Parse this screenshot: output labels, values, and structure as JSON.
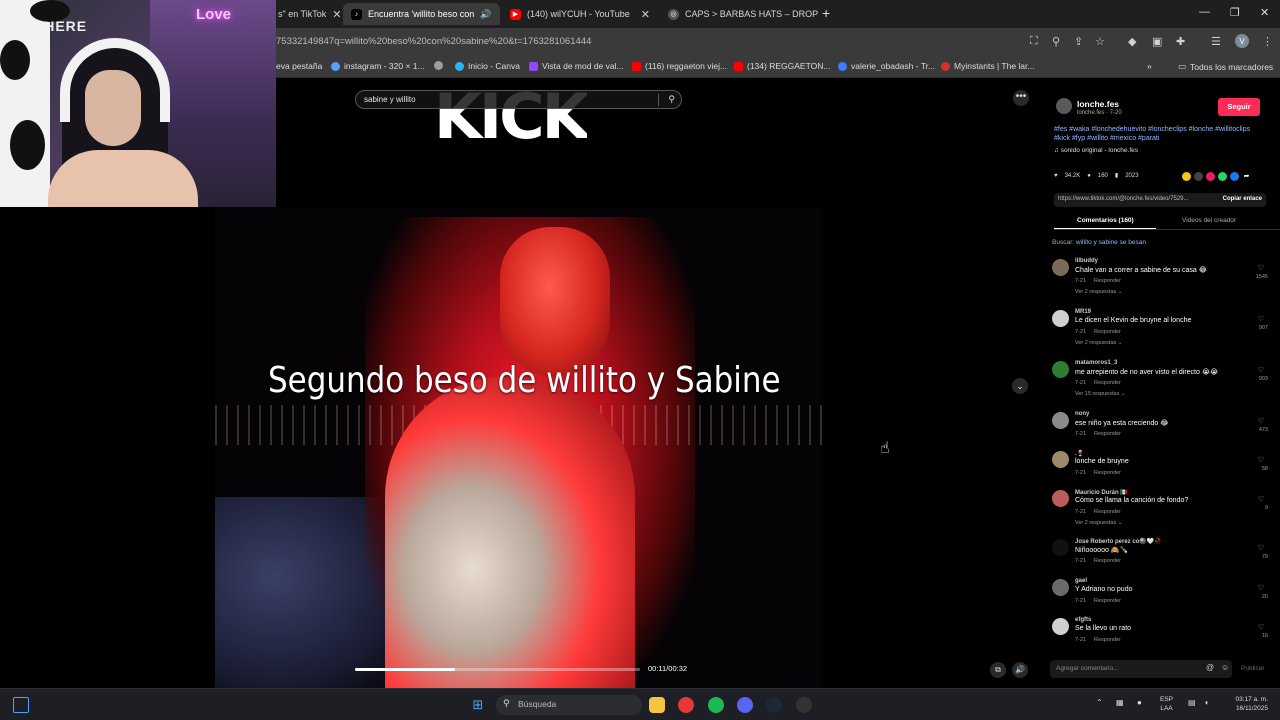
{
  "browser": {
    "tabs": [
      {
        "label": "s\" en TikTok",
        "active": false
      },
      {
        "label": "Encuentra 'willito beso con",
        "active": true
      },
      {
        "label": "(140) wilYCUH - YouTube",
        "active": false
      },
      {
        "label": "CAPS > BARBAS HATS – DROP",
        "active": false
      }
    ],
    "url": "75332149847q=willito%20beso%20con%20sabine%20&t=1763281061444",
    "bookmarks": [
      {
        "label": "eva pestaña",
        "color": "#3a3a3a"
      },
      {
        "label": "instagram - 320 × 1...",
        "color": "#4da3ff"
      },
      {
        "label": "",
        "color": "#9e9e9e"
      },
      {
        "label": "Inicio - Canva",
        "color": "#29b6f6"
      },
      {
        "label": "Vista de mod de val...",
        "color": "#9146ff"
      },
      {
        "label": "(116) reggaeton viej...",
        "color": "#ff0000"
      },
      {
        "label": "(134) REGGAETON...",
        "color": "#ff0000"
      },
      {
        "label": "valerie_obadash - Tr...",
        "color": "#3f7cff"
      },
      {
        "label": "Myinstants | The lar...",
        "color": "#d32f2f"
      }
    ],
    "all_bookmarks": "Todos los marcadores"
  },
  "webcam": {
    "neon_text": "Love",
    "logo_text": "WHERE"
  },
  "video": {
    "search_query": "sabine y willito",
    "brand": "KICK",
    "caption": "Segundo beso de willito y Sabine",
    "time": "00:11/00:32",
    "progress": 0.35
  },
  "post": {
    "username": "lonche.fes",
    "sub": "lonche.fes · 7-20",
    "follow_label": "Seguir",
    "hashtags": "#fes #waka #lonchedehuevito #loncheclips #lonche #willitoclips #kick #fyp #willito #mexico #parati",
    "sound": "sonido original - lonche.fes",
    "likes": "34.2K",
    "comments_count": "160",
    "saves": "2023",
    "link": "https://www.tiktok.com/@lonche.fes/video/7529...",
    "copy_label": "Copiar enlace",
    "tab_comments": "Comentarios (160)",
    "tab_videos": "Videos del creador",
    "search_label": "Buscar:",
    "search_suggestion": "willito y sabine se besan"
  },
  "comments": [
    {
      "name": "lilbuddy",
      "text": "Chale van a correr a sabine de su casa 😂",
      "date": "7-21",
      "reply": "Responder",
      "replies": "Ver 2 respuestas ⌄",
      "likes": "1545",
      "color": "#7a6a5a"
    },
    {
      "name": "MR19",
      "text": "Le dicen el Kevin de bruyne al lonche",
      "date": "7-21",
      "reply": "Responder",
      "replies": "Ver 2 respuestas ⌄",
      "likes": "907",
      "color": "#cfcfcf"
    },
    {
      "name": "matamoros1_3",
      "text": "me arrepiento de no aver visto el directo 😭😭",
      "date": "7-21",
      "reply": "Responder",
      "replies": "Ver 15 respuestas ⌄",
      "likes": "993",
      "color": "#2e7d32"
    },
    {
      "name": "nony",
      "text": "ese niño ya esta creciendo 😂",
      "date": "7-21",
      "reply": "Responder",
      "replies": "",
      "likes": "473",
      "color": "#8a8a8a"
    },
    {
      "name": ".🍷",
      "text": "lonche de bruyne",
      "date": "7-21",
      "reply": "Responder",
      "replies": "",
      "likes": "58",
      "color": "#9c8a6a"
    },
    {
      "name": "Mauricio Durán 🇲🇽",
      "text": "Cómo se llama la canción de fondo?",
      "date": "7-21",
      "reply": "Responder",
      "replies": "Ver 2 respuestas ⌄",
      "likes": "9",
      "color": "#b85c5c"
    },
    {
      "name": "Jose Roberto perez co🎱🤍🥀",
      "text": "Niñoooooo 🙈🍾",
      "date": "7-21",
      "reply": "Responder",
      "replies": "",
      "likes": "79",
      "color": "#111111"
    },
    {
      "name": "gael",
      "text": "Y Adriano no pudo",
      "date": "7-21",
      "reply": "Responder",
      "replies": "",
      "likes": "20",
      "color": "#6a6a6a"
    },
    {
      "name": "efgfts",
      "text": "Se la llevo un rato",
      "date": "7-21",
      "reply": "Responder",
      "replies": "",
      "likes": "16",
      "color": "#d0d0d0"
    }
  ],
  "comment_input": {
    "placeholder": "Agregar comentario...",
    "publish": "Publicar"
  },
  "taskbar": {
    "search_placeholder": "Búsqueda",
    "lang_1": "ESP",
    "lang_2": "LAA",
    "time": "03:17 a. m.",
    "date": "16/11/2025"
  }
}
